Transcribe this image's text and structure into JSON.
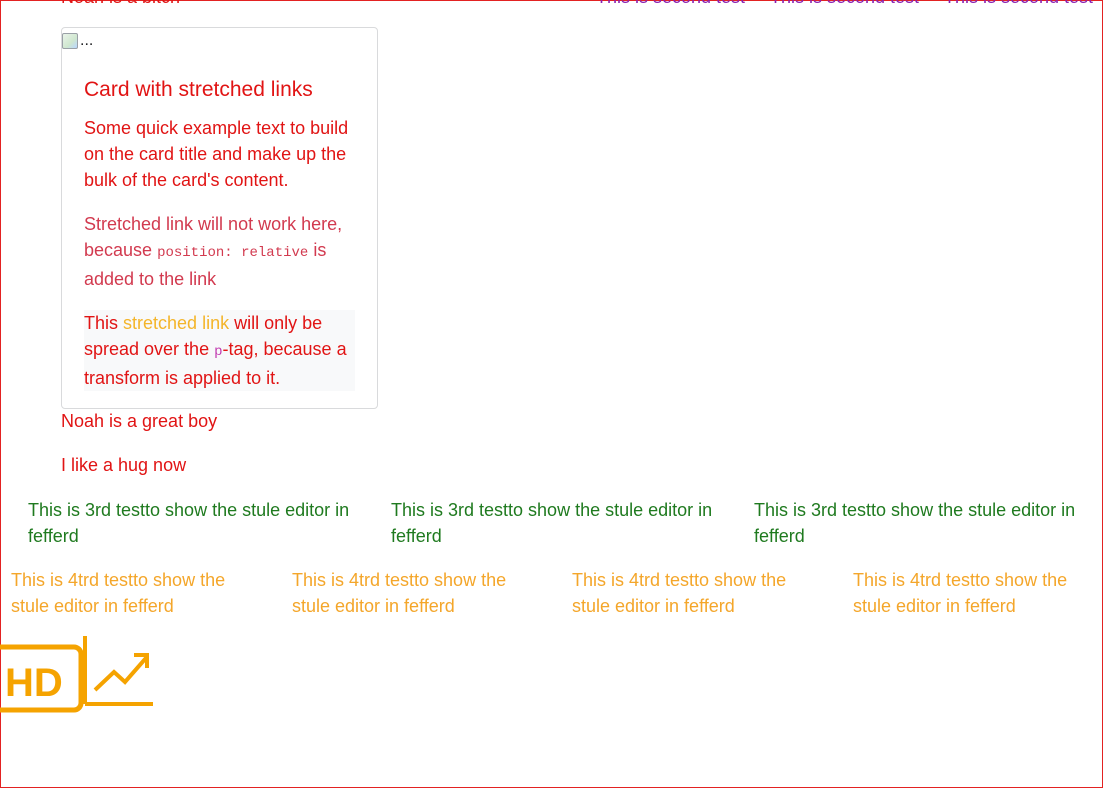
{
  "top": {
    "left_text": "Noah is a bitch",
    "right_items": [
      "This is second test",
      "This is second test",
      "This is second test"
    ]
  },
  "card": {
    "image_alt": "...",
    "title": "Card with stretched links",
    "text": "Some quick example text to build on the card title and make up the bulk of the card's content.",
    "note_prefix": "Stretched link will not work here, because",
    "note_code": "position: relative",
    "note_suffix": "is added to the link",
    "transform_prefix": "This",
    "transform_link": "stretched link",
    "transform_mid": "will only be spread over the",
    "transform_code": "p",
    "transform_suffix": "-tag, because a transform is applied to it."
  },
  "lines": {
    "great_boy": "Noah is a great boy",
    "hug": "I like a hug now"
  },
  "green_items": [
    "This is 3rd testto show the stule editor in fefferd",
    "This is 3rd testto show the stule editor in fefferd",
    "This is 3rd testto show the stule editor in fefferd"
  ],
  "orange_items": [
    "This is 4trd testto show the stule editor in fefferd",
    "This is 4trd testto show the stule editor in fefferd",
    "This is 4trd testto show the stule editor in fefferd",
    "This is 4trd testto show the stule editor in fefferd"
  ],
  "logo": {
    "text": "HD",
    "icon": "trend-up-icon",
    "color": "#f5a300"
  },
  "colors": {
    "red": "#e11414",
    "green": "#1f7a1f",
    "orange": "#f4a62a",
    "purple": "#8a1fb0",
    "frame": "#e32222"
  }
}
